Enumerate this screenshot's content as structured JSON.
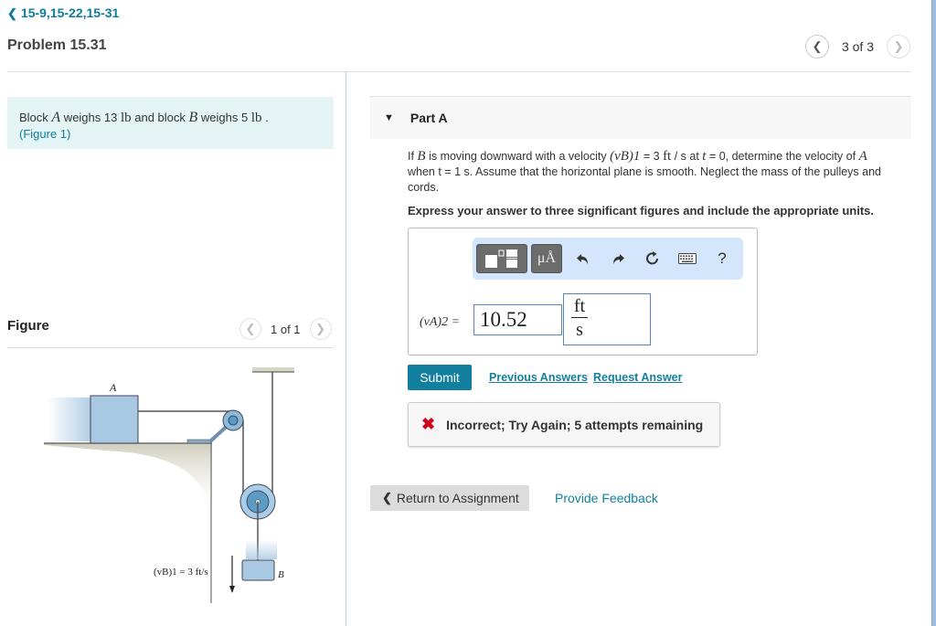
{
  "breadcrumb": {
    "label": "15-9,15-22,15-31",
    "icon": "chevron-left-icon"
  },
  "page_title": "Problem 15.31",
  "pager": {
    "prev_icon": "chevron-left-icon",
    "next_icon": "chevron-right-icon",
    "text": "3 of 3"
  },
  "intro": {
    "t1": "Block ",
    "var_a": "A",
    "t2": " weighs 13 ",
    "unit1": "lb",
    "t3": " and block ",
    "var_b": "B",
    "t4": " weighs 5 ",
    "unit2": "lb",
    "t5": " .",
    "figure_link": "(Figure 1)"
  },
  "figure": {
    "title": "Figure",
    "pager_text": "1 of 1",
    "labels": {
      "block_a": "A",
      "block_b": "B",
      "velocity": "(vB)1 = 3 ft/s"
    },
    "colors": {
      "block": "#a9c8e2",
      "pulley": "#5b9cc4",
      "ground": "#d8d6c8"
    }
  },
  "part": {
    "toggle_icon": "triangle-down-icon",
    "label": "Part A",
    "question": {
      "q1": "If ",
      "var_b": "B",
      "q2": " is moving downward with a velocity ",
      "vel_expr": "(vB)1",
      "q3": " = 3 ",
      "unit_ft": "ft",
      "q4": " / s at ",
      "var_t": "t",
      "q5": " = 0, determine the velocity of ",
      "var_a": "A",
      "q6": " when t = 1 s. Assume that the horizontal plane is smooth. Neglect the mass of the pulleys and cords."
    },
    "instruction": "Express your answer to three significant figures and include the appropriate units."
  },
  "answer": {
    "toolbar": {
      "templates_icon": "templates-icon",
      "units_label": "μÅ",
      "undo_icon": "undo-icon",
      "redo_icon": "redo-icon",
      "reset_icon": "reset-icon",
      "keyboard_icon": "keyboard-icon",
      "help_label": "?"
    },
    "label": "(vA)2 =",
    "value": "10.52",
    "unit_numerator": "ft",
    "unit_denominator": "s"
  },
  "actions": {
    "submit": "Submit",
    "previous_answers": "Previous Answers",
    "request_answer": "Request Answer"
  },
  "feedback": {
    "icon": "x-icon",
    "text": "Incorrect; Try Again; 5 attempts remaining",
    "color": "#d0021b"
  },
  "footer": {
    "return_label": "Return to Assignment",
    "provide_feedback": "Provide Feedback"
  },
  "colors": {
    "accent": "#137f9f",
    "intro_bg": "#e5f5f6",
    "toolbar_bg": "#d4e6fb"
  }
}
